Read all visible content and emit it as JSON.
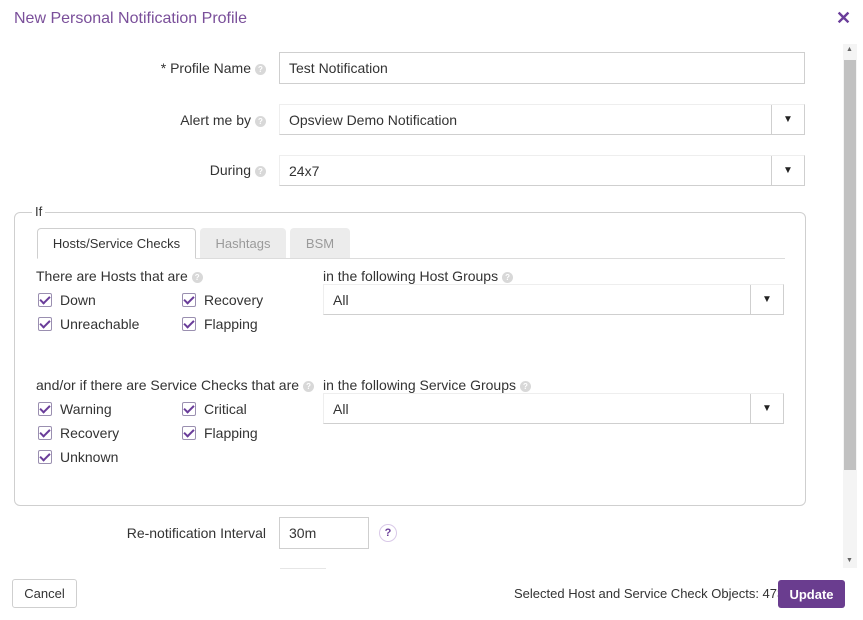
{
  "dialog": {
    "title": "New Personal Notification Profile",
    "close_icon": "✕"
  },
  "profile_name": {
    "label": "* Profile Name",
    "value": "Test Notification"
  },
  "alert_me_by": {
    "label": "Alert me by",
    "value": "Opsview Demo Notification"
  },
  "during": {
    "label": "During",
    "value": "24x7"
  },
  "if_group": {
    "legend": "If",
    "tabs": [
      "Hosts/Service Checks",
      "Hashtags",
      "BSM"
    ],
    "hosts_heading": "There are Hosts that are",
    "host_states": [
      {
        "label": "Down",
        "checked": true
      },
      {
        "label": "Recovery",
        "checked": true
      },
      {
        "label": "Unreachable",
        "checked": true
      },
      {
        "label": "Flapping",
        "checked": true
      }
    ],
    "host_groups_heading": "in the following Host Groups",
    "host_groups_value": "All",
    "services_heading": "and/or if there are Service Checks that are",
    "service_states": [
      {
        "label": "Warning",
        "checked": true
      },
      {
        "label": "Critical",
        "checked": true
      },
      {
        "label": "Recovery",
        "checked": true
      },
      {
        "label": "Flapping",
        "checked": true
      },
      {
        "label": "Unknown",
        "checked": true
      }
    ],
    "service_groups_heading": "in the following Service Groups",
    "service_groups_value": "All"
  },
  "renotification": {
    "label": "Re-notification Interval",
    "value": "30m",
    "help": "?"
  },
  "footer": {
    "cancel": "Cancel",
    "selected_text": "Selected Host and Service Check Objects: 473",
    "update": "Update"
  },
  "icons": {
    "help": "?",
    "dropdown": "▼"
  },
  "colors": {
    "accent": "#6a3d8f",
    "title": "#7a4f9a"
  }
}
